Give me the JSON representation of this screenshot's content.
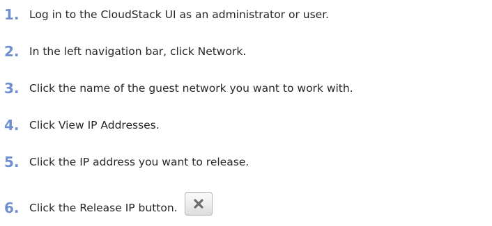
{
  "steps": [
    {
      "number": "1.",
      "text": "Log in to the CloudStack UI as an administrator or user."
    },
    {
      "number": "2.",
      "text": "In the left navigation bar, click Network."
    },
    {
      "number": "3.",
      "text": "Click the name of the guest network you want to work with."
    },
    {
      "number": "4.",
      "text": "Click View IP Addresses."
    },
    {
      "number": "5.",
      "text": "Click the IP address you want to release."
    },
    {
      "number": "6.",
      "text": "Click the Release IP button."
    }
  ],
  "release_button": {
    "icon": "close-x-icon"
  },
  "colors": {
    "step_number": "#6f8fcf",
    "step_text": "#262626",
    "icon": "#6b6b6b"
  }
}
